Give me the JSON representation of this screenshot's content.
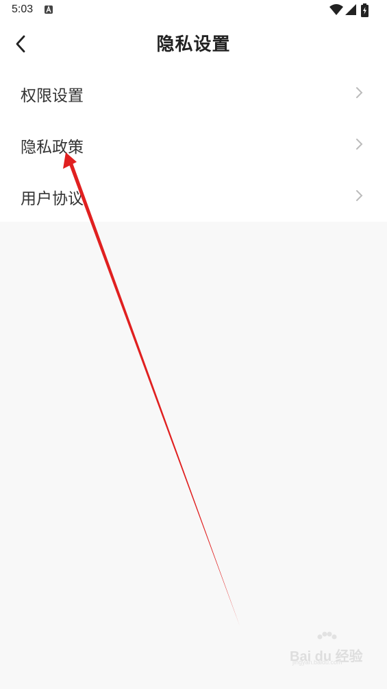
{
  "status_bar": {
    "time": "5:03",
    "icons": [
      "a-notification-icon",
      "wifi-icon",
      "signal-icon",
      "battery-charging-icon"
    ]
  },
  "header": {
    "title": "隐私设置",
    "back_icon": "chevron-left-icon"
  },
  "menu": {
    "items": [
      {
        "label": "权限设置",
        "icon": "chevron-right-icon"
      },
      {
        "label": "隐私政策",
        "icon": "chevron-right-icon"
      },
      {
        "label": "用户协议",
        "icon": "chevron-right-icon"
      }
    ]
  },
  "watermark": {
    "text": "Bai du 经验",
    "sub": "jingyan.baidu.com"
  },
  "colors": {
    "background": "#f8f8f8",
    "surface": "#ffffff",
    "text": "#333333",
    "chevron": "#bbbbbb",
    "annotation_arrow": "#e02020"
  }
}
